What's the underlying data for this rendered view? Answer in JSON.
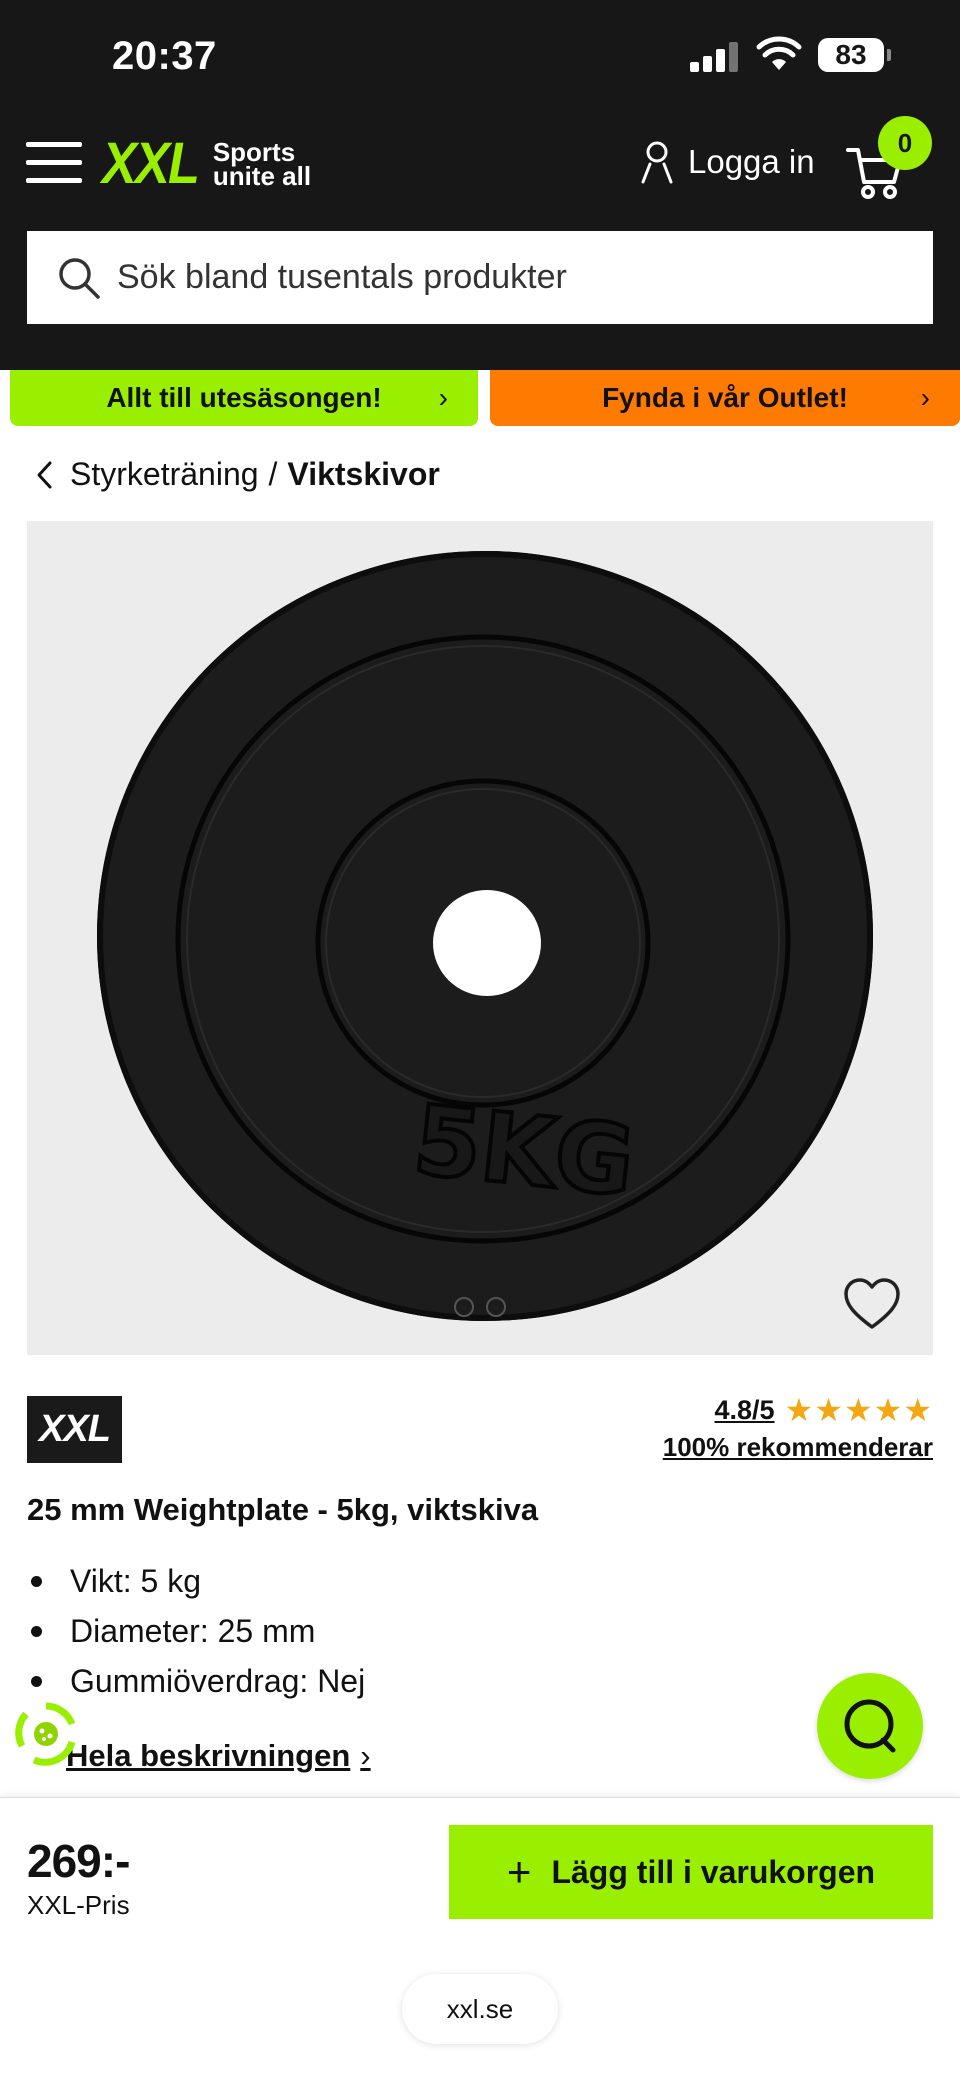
{
  "status_bar": {
    "time": "20:37",
    "battery": "83"
  },
  "header": {
    "logo_text": "XXL",
    "logo_tagline_1": "Sports",
    "logo_tagline_2": "unite all",
    "login_label": "Logga in",
    "cart_count": "0"
  },
  "search": {
    "placeholder": "Sök bland tusentals produkter"
  },
  "promos": [
    {
      "label": "Allt till utesäsongen!",
      "color": "#9aef00"
    },
    {
      "label": "Fynda i vår Outlet!",
      "color": "#ff7a00"
    }
  ],
  "breadcrumb": {
    "parent": "Styrketräning",
    "separator": "/",
    "current": "Viktskivor"
  },
  "product": {
    "plate_marking": "5KG",
    "image_count": 2,
    "brand": "XXL",
    "rating_score": "4.8/5",
    "rating_stars": "★★★★★",
    "recommend": "100% rekommenderar",
    "title": "25 mm Weightplate - 5kg, viktskiva",
    "specs": [
      "Vikt: 5 kg",
      "Diameter: 25 mm",
      "Gummiöverdrag: Nej"
    ],
    "description_link": "Hela beskrivningen"
  },
  "purchase": {
    "price": "269:-",
    "price_label": "XXL-Pris",
    "add_to_cart": "Lägg till i varukorgen"
  },
  "browser": {
    "url": "xxl.se"
  },
  "colors": {
    "accent": "#9aef00",
    "outlet": "#ff7a00",
    "header_bg": "#171717",
    "star": "#f3a712"
  }
}
